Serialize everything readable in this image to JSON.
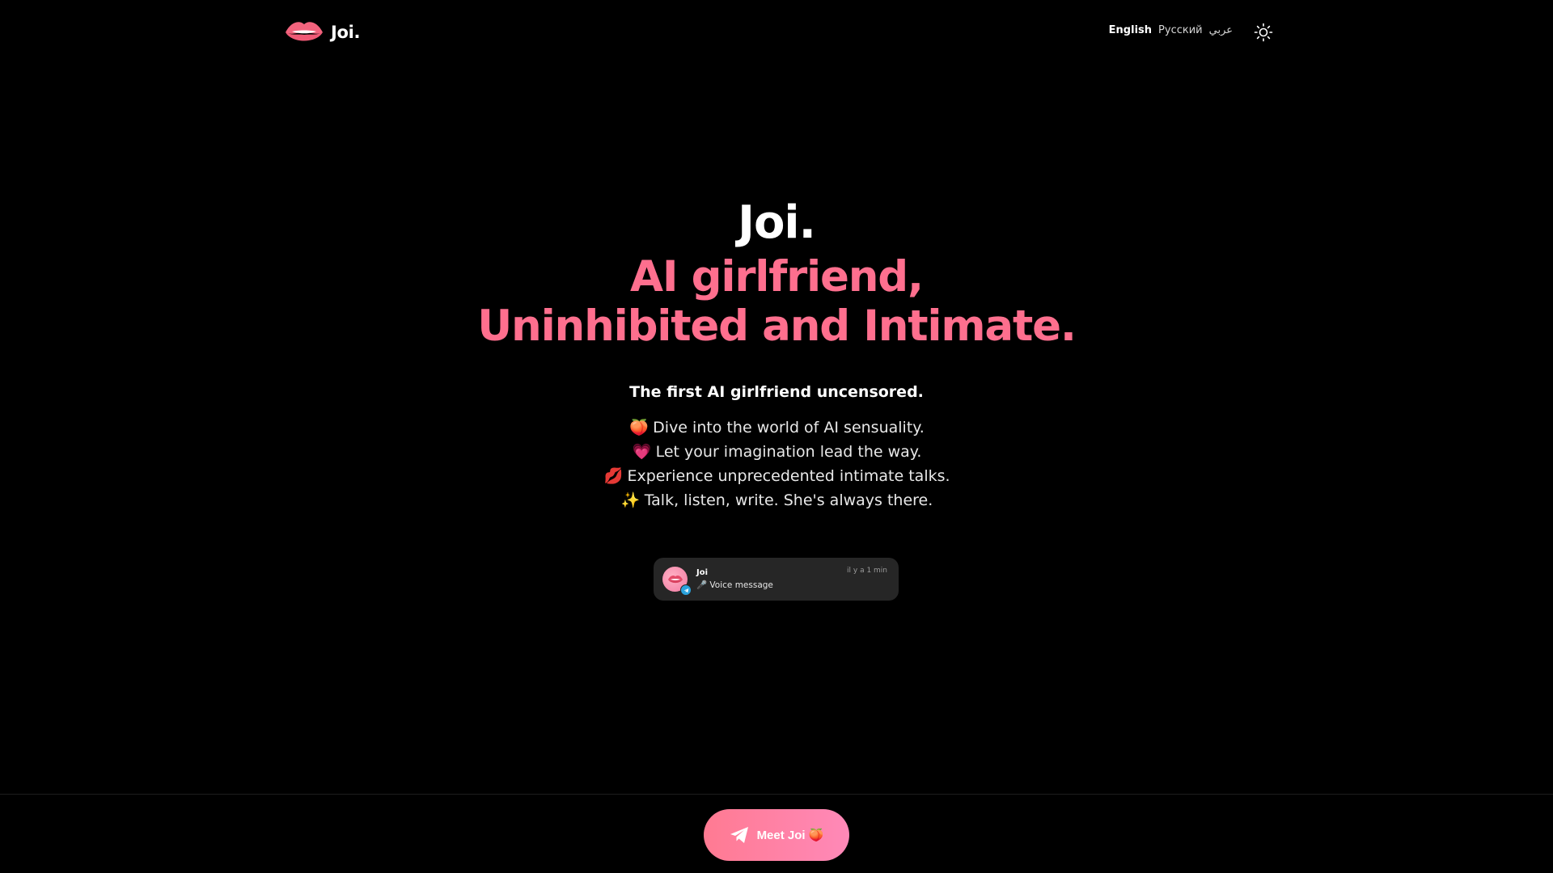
{
  "header": {
    "logo_icon": "lips-icon",
    "logo_text": "Joi.",
    "languages": [
      {
        "label": "English",
        "active": true
      },
      {
        "label": "Русский",
        "active": false
      },
      {
        "label": "عربي",
        "active": false
      }
    ],
    "theme_toggle_icon": "sun-icon"
  },
  "hero": {
    "brand": "Joi.",
    "title_line1": "AI girlfriend,",
    "title_line2": "Uninhibited and Intimate.",
    "tagline": "The first AI girlfriend uncensored.",
    "features": [
      {
        "emoji": "🍑",
        "text": "Dive into the world of AI sensuality."
      },
      {
        "emoji": "💗",
        "text": "Let your imagination lead the way."
      },
      {
        "emoji": "💋",
        "text": "Experience unprecedented intimate talks."
      },
      {
        "emoji": "✨",
        "text": "Talk, listen, write. She's always there."
      }
    ]
  },
  "notification": {
    "sender": "Joi",
    "message": "🎤 Voice message",
    "time": "il y a 1 min",
    "avatar_icon": "lips-icon",
    "badge_icon": "telegram-icon"
  },
  "cta": {
    "label": "Meet Joi 🍑",
    "icon": "telegram-plane-icon"
  },
  "colors": {
    "background": "#000000",
    "accent_pink": "#fe6f8e",
    "cta_gradient_start": "#ff7a92",
    "cta_gradient_end": "#ff89b8",
    "card_background": "#262626"
  }
}
